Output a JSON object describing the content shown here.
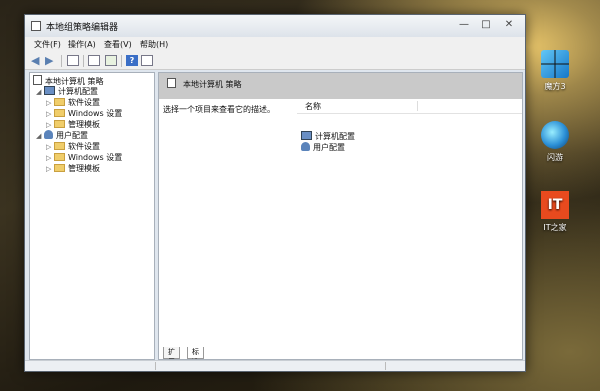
{
  "window": {
    "title": "本地组策略编辑器",
    "controls": {
      "minimize": "—",
      "maximize": "□",
      "close": "✕"
    }
  },
  "menu": [
    "文件(F)",
    "操作(A)",
    "查看(V)",
    "帮助(H)"
  ],
  "toolbar": {
    "icons": [
      "back-arrow-icon",
      "forward-arrow-icon",
      "show-tree-icon",
      "properties-icon",
      "export-list-icon",
      "help-icon",
      "show-hide-action-pane-icon"
    ],
    "back": "◀",
    "forward": "▶",
    "help": "?"
  },
  "tree": {
    "root": "本地计算机 策略",
    "computer": {
      "label": "计算机配置",
      "children": [
        "软件设置",
        "Windows 设置",
        "管理模板"
      ]
    },
    "user": {
      "label": "用户配置",
      "children": [
        "软件设置",
        "Windows 设置",
        "管理模板"
      ]
    },
    "expander": "▷",
    "collapser": "◢"
  },
  "details": {
    "header": "本地计算机 策略",
    "description": "选择一个项目来查看它的描述。",
    "column_name": "名称",
    "items": [
      "计算机配置",
      "用户配置"
    ]
  },
  "tabs": [
    "扩展",
    "标准"
  ],
  "desktop": [
    {
      "label": "魔方3",
      "icon": "magic-cube-icon"
    },
    {
      "label": "闪游",
      "icon": "shanyou-browser-icon"
    },
    {
      "label": "IT之家",
      "icon": "ithome-icon",
      "logo_text": "IT"
    }
  ],
  "colors": {
    "header_band": "#c9c9c9",
    "window_frame": "#dfe6ee",
    "folder": "#f0cd6a"
  }
}
